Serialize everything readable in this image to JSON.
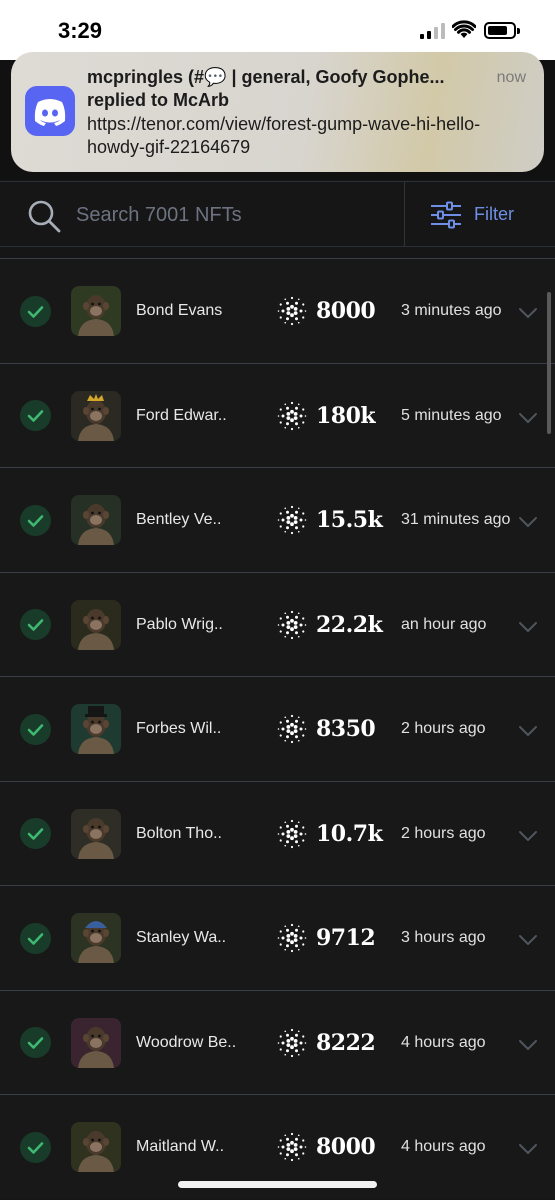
{
  "status_bar": {
    "time": "3:29"
  },
  "notification": {
    "title": "mcpringles (#💬 | general, Goofy Gophe...",
    "time": "now",
    "subtitle": "replied to McArb",
    "body": "https://tenor.com/view/forest-gump-wave-hi-hello-howdy-gif-22164679",
    "app_icon": "discord-icon"
  },
  "search": {
    "placeholder": "Search 7001 NFTs",
    "value": ""
  },
  "filter": {
    "label": "Filter"
  },
  "colors": {
    "accent": "#6f8fe6",
    "check_bg": "#183b2a",
    "check": "#3fb871",
    "background": "#161616"
  },
  "items": [
    {
      "name": "Bond Evans",
      "price": "8000",
      "time": "3 minutes ago",
      "avatar_bg": "#2f3a22",
      "hat": "none"
    },
    {
      "name": "Ford Edwar..",
      "price": "180k",
      "time": "5 minutes ago",
      "avatar_bg": "#2a2a22",
      "hat": "crown"
    },
    {
      "name": "Bentley Ve..",
      "price": "15.5k",
      "time": "31 minutes ago",
      "avatar_bg": "#273024",
      "hat": "none"
    },
    {
      "name": "Pablo Wrig..",
      "price": "22.2k",
      "time": "an hour ago",
      "avatar_bg": "#2b2b1d",
      "hat": "none"
    },
    {
      "name": "Forbes Wil..",
      "price": "8350",
      "time": "2 hours ago",
      "avatar_bg": "#1f3a30",
      "hat": "tophat"
    },
    {
      "name": "Bolton Tho..",
      "price": "10.7k",
      "time": "2 hours ago",
      "avatar_bg": "#2f2e26",
      "hat": "none"
    },
    {
      "name": "Stanley Wa..",
      "price": "9712",
      "time": "3 hours ago",
      "avatar_bg": "#2c3322",
      "hat": "beanie"
    },
    {
      "name": "Woodrow Be..",
      "price": "8222",
      "time": "4 hours ago",
      "avatar_bg": "#3a2430",
      "hat": "none"
    },
    {
      "name": "Maitland W..",
      "price": "8000",
      "time": "4 hours ago",
      "avatar_bg": "#2e321f",
      "hat": "none"
    }
  ]
}
